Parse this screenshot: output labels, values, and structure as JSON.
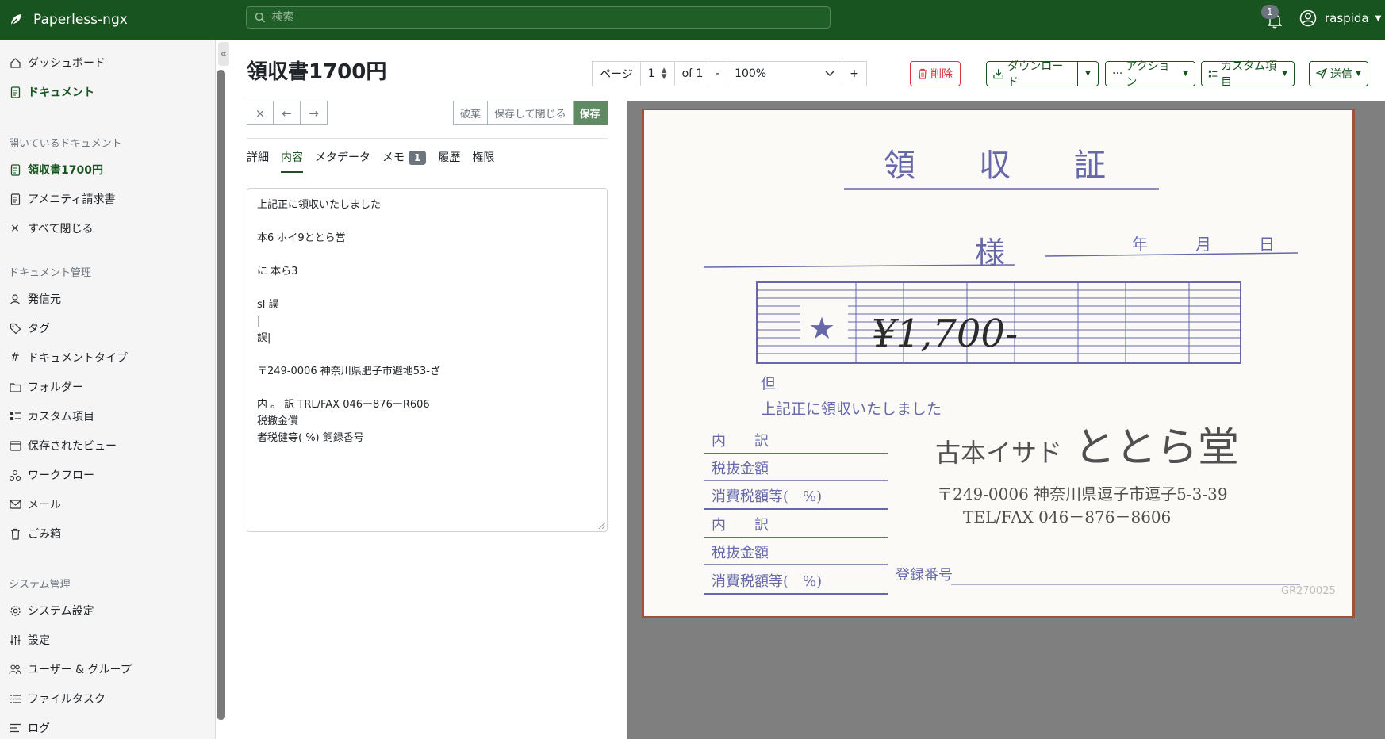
{
  "app": {
    "name": "Paperless-ngx"
  },
  "search": {
    "placeholder": "検索"
  },
  "notifications": {
    "count": "1"
  },
  "user": {
    "name": "raspida"
  },
  "sidebar": {
    "main": [
      {
        "label": "ダッシュボード",
        "icon": "house-icon"
      },
      {
        "label": "ドキュメント",
        "icon": "document-icon"
      }
    ],
    "open_docs_title": "開いているドキュメント",
    "open_docs": [
      {
        "label": "領収書1700円",
        "icon": "document-icon"
      },
      {
        "label": "アメニティ請求書",
        "icon": "document-icon"
      },
      {
        "label": "すべて閉じる",
        "icon": "close-icon"
      }
    ],
    "management_title": "ドキュメント管理",
    "management": [
      {
        "label": "発信元",
        "icon": "person-icon"
      },
      {
        "label": "タグ",
        "icon": "tag-icon"
      },
      {
        "label": "ドキュメントタイプ",
        "icon": "hash-icon"
      },
      {
        "label": "フォルダー",
        "icon": "folder-icon"
      },
      {
        "label": "カスタム項目",
        "icon": "ui-checks-icon"
      },
      {
        "label": "保存されたビュー",
        "icon": "window-icon"
      },
      {
        "label": "ワークフロー",
        "icon": "workflow-icon"
      },
      {
        "label": "メール",
        "icon": "envelope-icon"
      },
      {
        "label": "ごみ箱",
        "icon": "trash-icon"
      }
    ],
    "system_title": "システム管理",
    "system": [
      {
        "label": "システム設定",
        "icon": "gear-icon"
      },
      {
        "label": "設定",
        "icon": "sliders-icon"
      },
      {
        "label": "ユーザー & グループ",
        "icon": "people-icon"
      },
      {
        "label": "ファイルタスク",
        "icon": "list-task-icon"
      },
      {
        "label": "ログ",
        "icon": "text-left-icon"
      }
    ]
  },
  "document": {
    "title": "領収書1700円"
  },
  "pager": {
    "label": "ページ",
    "current": "1",
    "of": "of 1"
  },
  "zoom": {
    "minus": "-",
    "value": "100%",
    "plus": "+"
  },
  "actions": {
    "delete": "削除",
    "download": "ダウンロード",
    "actions": "アクション",
    "custom_fields": "カスタム項目",
    "send": "送信"
  },
  "editbar": {
    "discard": "破棄",
    "save_close": "保存して閉じる",
    "save": "保存"
  },
  "tabs": [
    {
      "label": "詳細"
    },
    {
      "label": "内容"
    },
    {
      "label": "メタデータ"
    },
    {
      "label": "メモ",
      "count": "1"
    },
    {
      "label": "履歴"
    },
    {
      "label": "権限"
    }
  ],
  "content_text": "上記正に領収いたしました\n\n本6 ホイ9ととら営\n\nに 本ら3\n\nsl 誤\n|\n誤|\n\n〒249-0006 神奈川県肥子市避地53-ざ\n\n内 。 訳 TRL/FAX 046ー876ーR606\n税撤金償\n者税健等( %) 飼録香号",
  "receipt": {
    "title": "領　　収　　証",
    "sama": "様",
    "date": "年　　　月　　　日",
    "amount": "¥1,700-",
    "tadashi": "但",
    "received": "上記正に領収いたしました",
    "uchiwake": "内　　訳",
    "zeinuki": "税抜金額",
    "shohizei": "消費税額等(　%)",
    "shop_prefix": "古本イサド",
    "shop_name": "ととら堂",
    "address": "〒249-0006  神奈川県逗子市逗子5-3-39",
    "tel": "TEL/FAX 046－876－8606",
    "registration": "登録番号",
    "code": "GR270025"
  },
  "colors": {
    "brand": "#17541f",
    "ink": "#5b5ca8",
    "danger": "#dc3545"
  }
}
